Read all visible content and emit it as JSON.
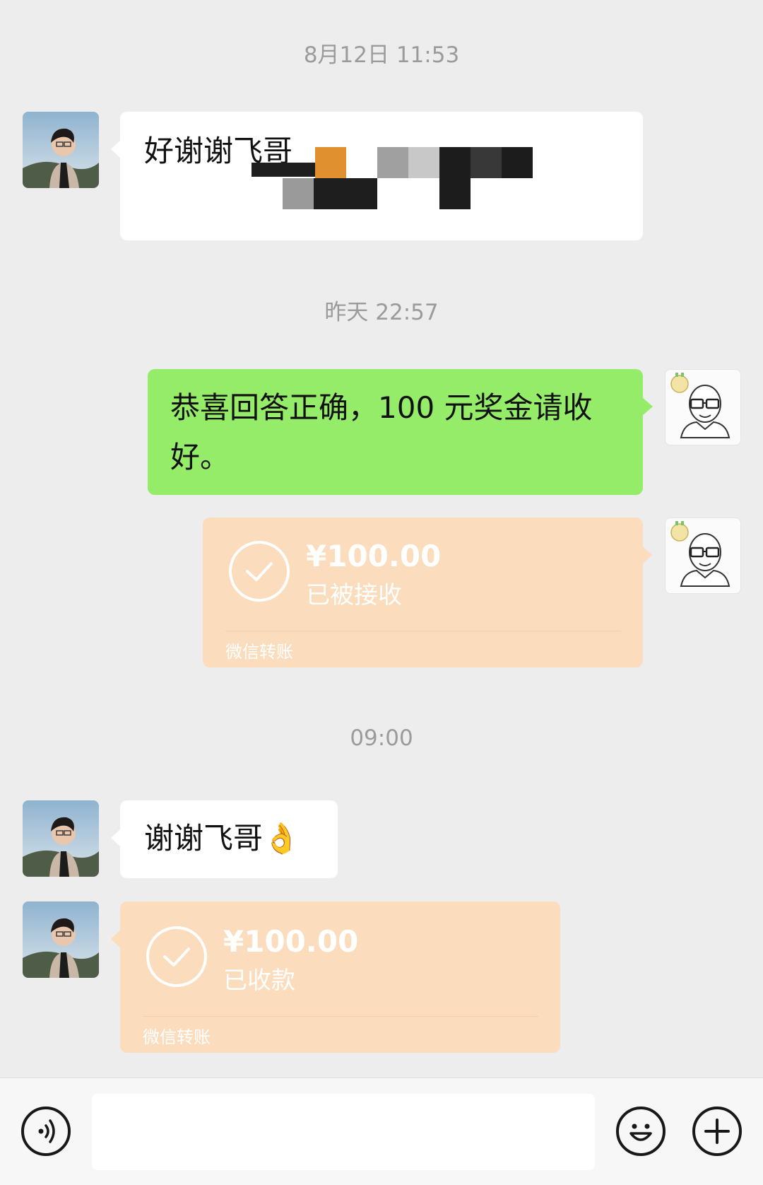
{
  "timestamps": {
    "first": "8月12日 11:53",
    "second": "昨天 22:57",
    "third": "09:00"
  },
  "messages": {
    "m1": {
      "text": "好谢谢飞哥"
    },
    "m2": {
      "text_line1": "恭喜回答正确，100 元奖金请收",
      "text_line2": "好。"
    },
    "m3": {
      "amount": "¥100.00",
      "status": "已被接收",
      "brand": "微信转账"
    },
    "m4": {
      "text": "谢谢飞哥👌"
    },
    "m5": {
      "amount": "¥100.00",
      "status": "已收款",
      "brand": "微信转账"
    }
  },
  "colors": {
    "background": "#ededed",
    "my_bubble": "#95ec69",
    "their_bubble": "#ffffff",
    "transfer_bubble": "#fbdcbc",
    "timestamp_text": "#9b9b9b"
  },
  "icons": {
    "voice": "voice-icon",
    "emoji": "emoji-icon",
    "more": "plus-icon"
  }
}
